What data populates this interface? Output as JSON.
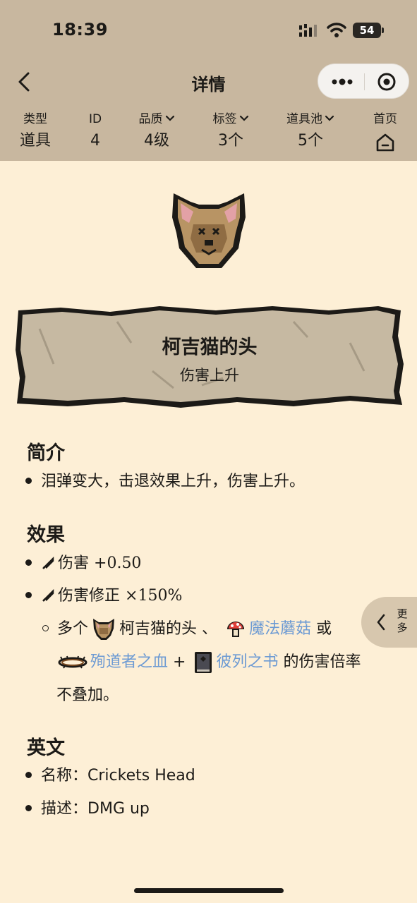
{
  "status_bar": {
    "time": "18:39",
    "battery": "54"
  },
  "nav": {
    "title": "详情"
  },
  "stats": [
    {
      "label": "类型",
      "value": "道具"
    },
    {
      "label": "ID",
      "value": "4"
    },
    {
      "label": "品质",
      "value": "4级"
    },
    {
      "label": "标签",
      "value": "3个"
    },
    {
      "label": "道具池",
      "value": "5个"
    },
    {
      "label": "首页",
      "value": ""
    }
  ],
  "item": {
    "name": "柯吉猫的头",
    "subtitle": "伤害上升"
  },
  "intro": {
    "heading": "简介",
    "text": "泪弹变大，击退效果上升，伤害上升。"
  },
  "effects": {
    "heading": "效果",
    "damage_label": "伤害",
    "damage_value": "+0.50",
    "multiplier_label": "伤害修正",
    "multiplier_value": "×150%",
    "note_prefix": "多个",
    "note_item_self": "柯吉猫的头",
    "note_sep": "、",
    "note_link_1": "魔法蘑菇",
    "note_or": "或",
    "note_link_2": "殉道者之血",
    "note_plus": "+",
    "note_link_3": "彼列之书",
    "note_suffix": "的伤害倍率",
    "note_line3": "不叠加。"
  },
  "english": {
    "heading": "英文",
    "name_label": "名称：",
    "name_value": "Crickets Head",
    "desc_label": "描述：",
    "desc_value": "DMG up"
  },
  "side_more": {
    "label_1": "更",
    "label_2": "多"
  },
  "colors": {
    "header_bg": "#c8b79f",
    "page_bg": "#fdefd6",
    "link": "#6c9ad3"
  }
}
